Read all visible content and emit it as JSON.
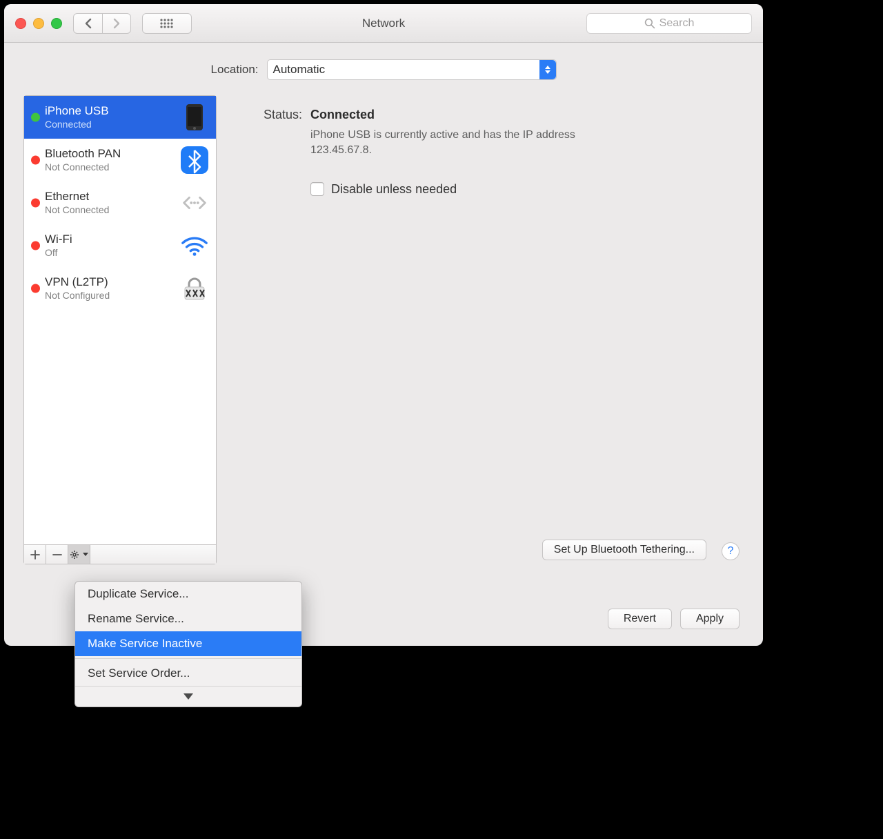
{
  "window": {
    "title": "Network",
    "search_placeholder": "Search"
  },
  "location": {
    "label": "Location:",
    "value": "Automatic"
  },
  "services": [
    {
      "name": "iPhone USB",
      "status": "Connected",
      "dot": "green",
      "icon": "iphone",
      "selected": true
    },
    {
      "name": "Bluetooth PAN",
      "status": "Not Connected",
      "dot": "red",
      "icon": "bluetooth"
    },
    {
      "name": "Ethernet",
      "status": "Not Connected",
      "dot": "red",
      "icon": "ethernet"
    },
    {
      "name": "Wi-Fi",
      "status": "Off",
      "dot": "red",
      "icon": "wifi"
    },
    {
      "name": "VPN (L2TP)",
      "status": "Not Configured",
      "dot": "red",
      "icon": "vpn"
    }
  ],
  "detail": {
    "status_label": "Status:",
    "status_value": "Connected",
    "description": "iPhone USB is currently active and has the IP address 123.45.67.8.",
    "checkbox_label": "Disable unless needed",
    "advanced_button": "Set Up Bluetooth Tethering..."
  },
  "footer": {
    "revert": "Revert",
    "apply": "Apply"
  },
  "popup": {
    "items": [
      "Duplicate Service...",
      "Rename Service...",
      "Make Service Inactive",
      "Set Service Order..."
    ],
    "selected_index": 2
  }
}
